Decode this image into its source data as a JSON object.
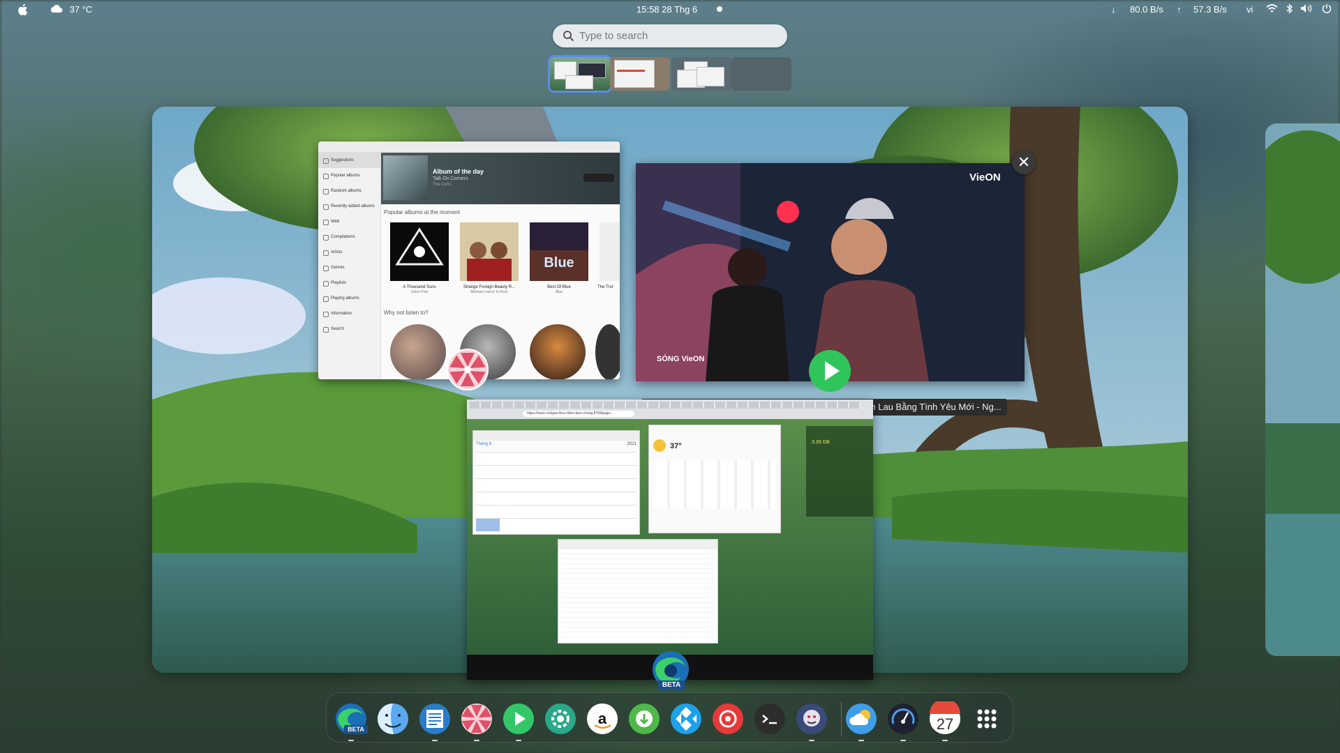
{
  "topbar": {
    "weather": "37 °C",
    "clock": "15:58  28 Thg 6",
    "net_down": "80.0  B/s",
    "net_up": "57.3  B/s",
    "lang": "vi"
  },
  "search": {
    "placeholder": "Type to search"
  },
  "music_app": {
    "sidebar": [
      "Suggestions",
      "Popular albums",
      "Random albums",
      "Recently added albums",
      "Web",
      "Compilations",
      "Artists",
      "Genres",
      "Playlists",
      "Playing albums",
      "Information",
      "Search"
    ],
    "hero_title": "Album of the day",
    "hero_album": "Talk On Corners",
    "hero_artist": "The Corrs",
    "section1": "Popular albums at the moment",
    "albums": [
      {
        "title": "A Thousand Suns",
        "artist": "Linkin Park"
      },
      {
        "title": "Strange Foreign Beauty R...",
        "artist": "Michael Learns To Rock"
      },
      {
        "title": "Best Of Blue",
        "artist": "Blue"
      },
      {
        "title": "The Trut",
        "artist": ""
      }
    ],
    "section2": "Why not listen to?"
  },
  "video": {
    "logo": "VieON",
    "logo2": "SÓNG VieON"
  },
  "tooltip": "Tóc Tiên - DaLAB live CỰC ĐỈNH loạt HIT Nước Mắt Em Lau Bằng Tình Yêu Mới - Ng...",
  "browser": {
    "url": "https://vieon.vn/giao-thuc-thien-kien-chung.8784/page..."
  },
  "inner": {
    "calendar_month": "Tháng 6",
    "calendar_year": "2021",
    "weather_temp": "37°",
    "sysinfo": "3.39 GB"
  },
  "dock_badge": "BETA",
  "calendar_day": "27",
  "colors": {
    "accent": "#5b8de8",
    "dock_bg": "#283732"
  }
}
